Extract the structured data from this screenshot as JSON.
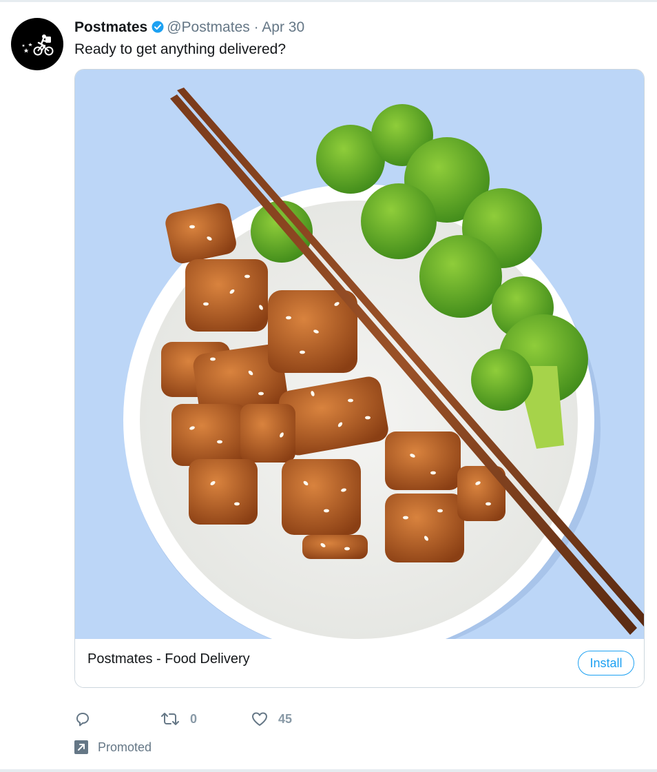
{
  "tweet": {
    "display_name": "Postmates",
    "handle": "@Postmates",
    "separator": "·",
    "date": "Apr 30",
    "text": "Ready to get anything delivered?"
  },
  "card": {
    "title": "Postmates - Food Delivery",
    "install_label": "Install",
    "image_subject": "bowl of teriyaki chicken with sesame seeds, rice and broccoli with chopsticks on a light blue background"
  },
  "actions": {
    "reply_icon": "reply-icon",
    "retweet_icon": "retweet-icon",
    "retweet_count": "0",
    "like_icon": "heart-icon",
    "like_count": "45"
  },
  "promoted": {
    "label": "Promoted",
    "icon": "promoted-arrow-icon"
  },
  "colors": {
    "accent": "#1da1f2",
    "muted": "#657786",
    "card_background": "#bcd6f7",
    "avatar_background": "#000000"
  }
}
